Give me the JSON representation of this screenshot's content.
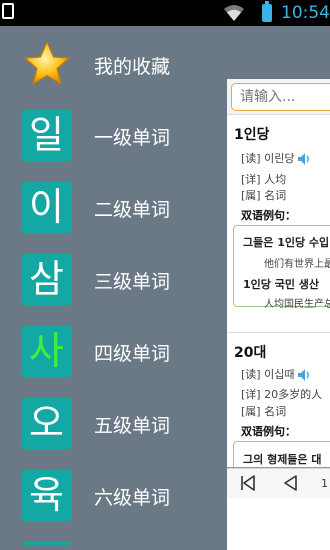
{
  "status_bar": {
    "time": "10:54"
  },
  "drawer": {
    "items": [
      {
        "label": "我的收藏",
        "icon": "star-icon"
      },
      {
        "label": "一级单词",
        "tile": "일"
      },
      {
        "label": "二级单词",
        "tile": "이"
      },
      {
        "label": "三级单词",
        "tile": "삼"
      },
      {
        "label": "四级单词",
        "tile": "사"
      },
      {
        "label": "五级单词",
        "tile": "오"
      },
      {
        "label": "六级单词",
        "tile": "육"
      }
    ]
  },
  "panel": {
    "search": {
      "placeholder": "请输入..."
    },
    "entries": [
      {
        "word": "1인당",
        "reading": "[读] 이린당",
        "meaning": "[详] 人均",
        "pos": "[属] 名词",
        "examples_title": "双语例句：",
        "examples": [
          {
            "ko": "그들은 1인당 수입",
            "zh": "他们有世界上最"
          },
          {
            "ko": "1인당 국민 생산",
            "zh": "人均国民生产总"
          }
        ]
      },
      {
        "word": "20대",
        "reading": "[读] 이십때",
        "meaning": "[详] 20多岁的人",
        "pos": "[属] 名词",
        "examples_title": "双语例句：",
        "examples": [
          {
            "ko": "그의 형제들은 대"
          }
        ]
      }
    ],
    "pager": {
      "page": "1"
    }
  },
  "colors": {
    "drawer_bg": "#6b7886",
    "tile": "#14a8a4",
    "accent": "#3ab4e6",
    "search_border": "#f0a838"
  }
}
